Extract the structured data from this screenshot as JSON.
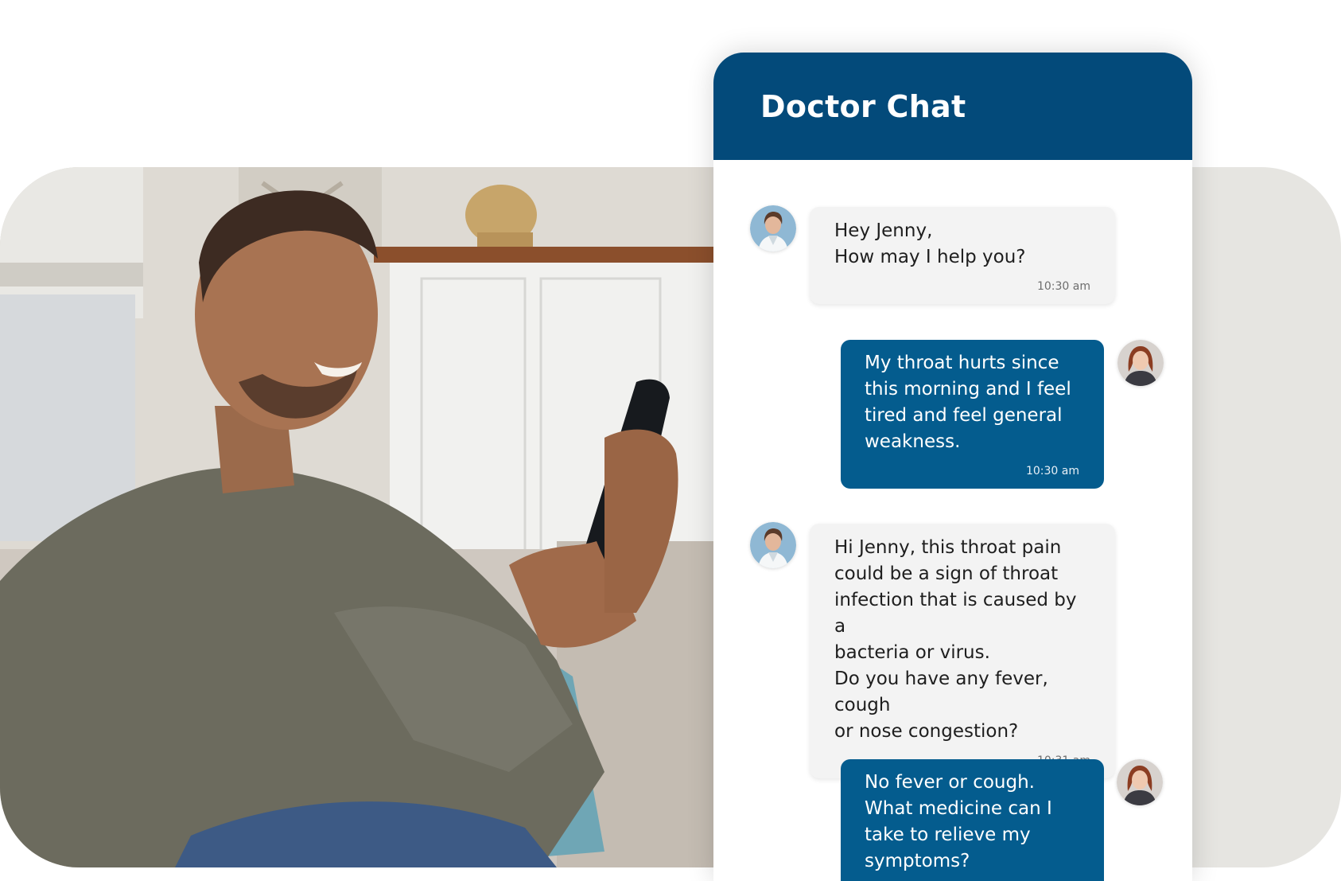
{
  "chat": {
    "title": "Doctor Chat",
    "messages": [
      {
        "sender": "doctor",
        "text": "Hey Jenny,\nHow may I help you?",
        "time": "10:30 am"
      },
      {
        "sender": "patient",
        "text": "My throat hurts since\nthis morning and I feel\ntired and feel general\nweakness.",
        "time": "10:30 am"
      },
      {
        "sender": "doctor",
        "text": "Hi Jenny, this throat pain\ncould be a sign of throat\ninfection that is caused by a\nbacteria or virus.\nDo you have any fever, cough\nor nose congestion?",
        "time": "10:31 am"
      },
      {
        "sender": "patient",
        "text": "No fever or cough.\nWhat medicine can I\ntake to relieve my\nsymptoms?"
      }
    ]
  },
  "colors": {
    "header": "#034a7a",
    "patient_bubble": "#045c8e",
    "doctor_bubble": "#f3f3f3",
    "backdrop": "#e6e5e1"
  },
  "icons": {
    "doctor_avatar": "doctor-avatar",
    "patient_avatar": "patient-avatar"
  }
}
